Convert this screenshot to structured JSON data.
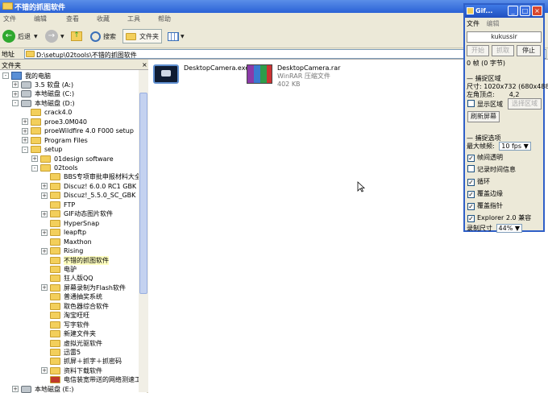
{
  "explorer": {
    "title": "不错的抓图软件",
    "menu": [
      "文件",
      "编辑",
      "查看",
      "收藏",
      "工具",
      "帮助"
    ],
    "toolbar": {
      "back": "后退",
      "search": "搜索",
      "folders": "文件夹"
    },
    "address_label": "地址",
    "address": "D:\\setup\\02tools\\不错的抓图软件",
    "folder_pane_title": "文件夹",
    "folder_pane_close": "×",
    "tree": [
      {
        "label": "我的电脑",
        "level": 0,
        "exp": "-",
        "icon": "pc"
      },
      {
        "label": "3.5 软盘 (A:)",
        "level": 1,
        "exp": "+",
        "icon": "drive"
      },
      {
        "label": "本地磁盘 (C:)",
        "level": 1,
        "exp": "+",
        "icon": "drive"
      },
      {
        "label": "本地磁盘 (D:)",
        "level": 1,
        "exp": "-",
        "icon": "drive"
      },
      {
        "label": "crack4.0",
        "level": 2,
        "exp": "",
        "icon": "folder"
      },
      {
        "label": "proe3.0M040",
        "level": 2,
        "exp": "+",
        "icon": "folder"
      },
      {
        "label": "proeWildfire 4.0 F000 setup",
        "level": 2,
        "exp": "+",
        "icon": "folder"
      },
      {
        "label": "Program Files",
        "level": 2,
        "exp": "+",
        "icon": "folder"
      },
      {
        "label": "setup",
        "level": 2,
        "exp": "-",
        "icon": "folder"
      },
      {
        "label": "01design software",
        "level": 3,
        "exp": "+",
        "icon": "folder"
      },
      {
        "label": "02tools",
        "level": 3,
        "exp": "-",
        "icon": "folder"
      },
      {
        "label": "BBS专项审批申报材料大全-",
        "level": 4,
        "exp": "",
        "icon": "folder"
      },
      {
        "label": "Discuz! 6.0.0 RC1 GBK 简",
        "level": 4,
        "exp": "+",
        "icon": "folder"
      },
      {
        "label": "Discuz!_5.5.0_SC_GBK",
        "level": 4,
        "exp": "+",
        "icon": "folder"
      },
      {
        "label": "FTP",
        "level": 4,
        "exp": "",
        "icon": "folder"
      },
      {
        "label": "GIF动态图片软件",
        "level": 4,
        "exp": "+",
        "icon": "folder"
      },
      {
        "label": "HyperSnap",
        "level": 4,
        "exp": "",
        "icon": "folder"
      },
      {
        "label": "leapftp",
        "level": 4,
        "exp": "+",
        "icon": "folder"
      },
      {
        "label": "Maxthon",
        "level": 4,
        "exp": "",
        "icon": "folder"
      },
      {
        "label": "Rising",
        "level": 4,
        "exp": "+",
        "icon": "folder"
      },
      {
        "label": "不错的抓图软件",
        "level": 4,
        "exp": "",
        "icon": "folder",
        "selected": true
      },
      {
        "label": "电驴",
        "level": 4,
        "exp": "",
        "icon": "folder"
      },
      {
        "label": "狂人版QQ",
        "level": 4,
        "exp": "",
        "icon": "folder"
      },
      {
        "label": "屏幕录制为Flash软件",
        "level": 4,
        "exp": "+",
        "icon": "folder"
      },
      {
        "label": "普通抽奖系统",
        "level": 4,
        "exp": "",
        "icon": "folder"
      },
      {
        "label": "取色器综合软件",
        "level": 4,
        "exp": "",
        "icon": "folder"
      },
      {
        "label": "淘宝旺旺",
        "level": 4,
        "exp": "",
        "icon": "folder"
      },
      {
        "label": "写字软件",
        "level": 4,
        "exp": "",
        "icon": "folder"
      },
      {
        "label": "新建文件夹",
        "level": 4,
        "exp": "",
        "icon": "folder"
      },
      {
        "label": "虚拟光驱软件",
        "level": 4,
        "exp": "",
        "icon": "folder"
      },
      {
        "label": "迅雷5",
        "level": 4,
        "exp": "",
        "icon": "folder"
      },
      {
        "label": "抓屏＋抓字＋抓密码",
        "level": 4,
        "exp": "",
        "icon": "folder"
      },
      {
        "label": "资料下载软件",
        "level": 4,
        "exp": "+",
        "icon": "folder"
      },
      {
        "label": "电信装宽带送的网络测速工",
        "level": 4,
        "exp": "",
        "icon": "file"
      },
      {
        "label": "本地磁盘 (E:)",
        "level": 1,
        "exp": "+",
        "icon": "drive"
      }
    ],
    "files": [
      {
        "name": "DesktopCamera.exe",
        "sub1": "",
        "sub2": ""
      },
      {
        "name": "DesktopCamera.rar",
        "sub1": "WinRAR 压缩文件",
        "sub2": "402 KB"
      }
    ]
  },
  "gif": {
    "title": "Gif...",
    "menu": [
      "文件",
      "编辑"
    ],
    "user": "kukussir",
    "buttons": {
      "start": "开始",
      "capture": "抓取",
      "stop": "停止"
    },
    "frames": "0 帧 (0 字节)",
    "capture_area": "捕捉区域",
    "size": "尺寸: 1020x732 (680x488)",
    "topleft_label": "左角顶点:",
    "topleft_value": "4,2",
    "show_area": "显示区域",
    "select_area": "选择区域",
    "refresh": "刷新屏幕",
    "capture_options": "捕捉选项",
    "max_fps_label": "最大帧频:",
    "max_fps": "10 fps",
    "frame_transparent": "帧间透明",
    "record_time": "记录时间信息",
    "loop": "循环",
    "overlay_edges": "覆盖边缘",
    "overlay_pointer": "覆盖指针",
    "explorer_compat": "Explorer 2.0 兼容",
    "record_size_label": "录制尺寸",
    "record_size": "44%",
    "checks": {
      "show_area": false,
      "frame_transparent": true,
      "record_time": false,
      "loop": true,
      "overlay_edges": true,
      "overlay_pointer": true,
      "explorer_compat": true
    }
  },
  "colors": {
    "xp_blue": "#2a62d6",
    "selection": "#ffffc0",
    "chrome": "#ece9d8"
  }
}
